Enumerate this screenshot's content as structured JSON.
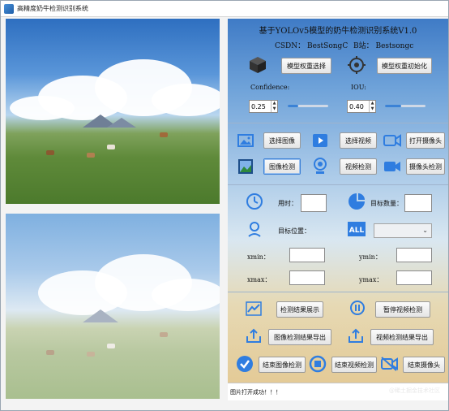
{
  "window": {
    "title": "高精度奶牛检测识别系统"
  },
  "header": {
    "title": "基于YOLOv5模型的奶牛检测识别系统V1.0",
    "csdn": "CSDN：  BestSongC",
    "bzhan": "B站：  Bestsongc"
  },
  "model": {
    "select_label": "模型权重选择",
    "init_label": "模型权重初始化"
  },
  "params": {
    "confidence_label": "Confidence:",
    "iou_label": "IOU:",
    "confidence_value": "0.25",
    "iou_value": "0.40",
    "confidence_level": 0.25,
    "iou_level": 0.4
  },
  "media": {
    "select_image": "选择图像",
    "select_video": "选择视频",
    "open_camera": "打开摄像头",
    "image_detect": "图像检测",
    "video_detect": "视频检测",
    "camera_detect": "摄像头检测"
  },
  "results": {
    "time_label": "用时：",
    "count_label": "目标数量：",
    "position_label": "目标位置：",
    "xmin_label": "xmin：",
    "ymin_label": "ymin：",
    "xmax_label": "xmax：",
    "ymax_label": "ymax：",
    "time_value": "",
    "count_value": "",
    "xmin_value": "",
    "ymin_value": "",
    "xmax_value": "",
    "ymax_value": "",
    "target_select_value": ""
  },
  "actions": {
    "show_results": "检测结果展示",
    "pause_video": "暂停视频检测",
    "export_image": "图像检测结果导出",
    "export_video": "视频检测结果导出",
    "end_image": "结束图像检测",
    "end_video": "结束视频检测",
    "end_camera": "结束摄像头"
  },
  "status": {
    "message": "图片打开成功！！！",
    "watermark": "@稀土掘金技术社区"
  },
  "colors": {
    "accent_blue": "#2f7de0",
    "panel_top": "#3f7bc6",
    "panel_bottom": "#e3c790"
  },
  "icons": [
    "cube-icon",
    "crosshair-icon",
    "image-icon",
    "video-play-icon",
    "camera-icon",
    "image-detect-icon",
    "webcam-icon",
    "video-camera-icon",
    "clock-icon",
    "pie-chart-icon",
    "location-icon",
    "all-icon",
    "line-chart-icon",
    "pause-icon",
    "upload-icon",
    "check-circle-icon",
    "stop-circle-icon",
    "camera-off-icon"
  ]
}
